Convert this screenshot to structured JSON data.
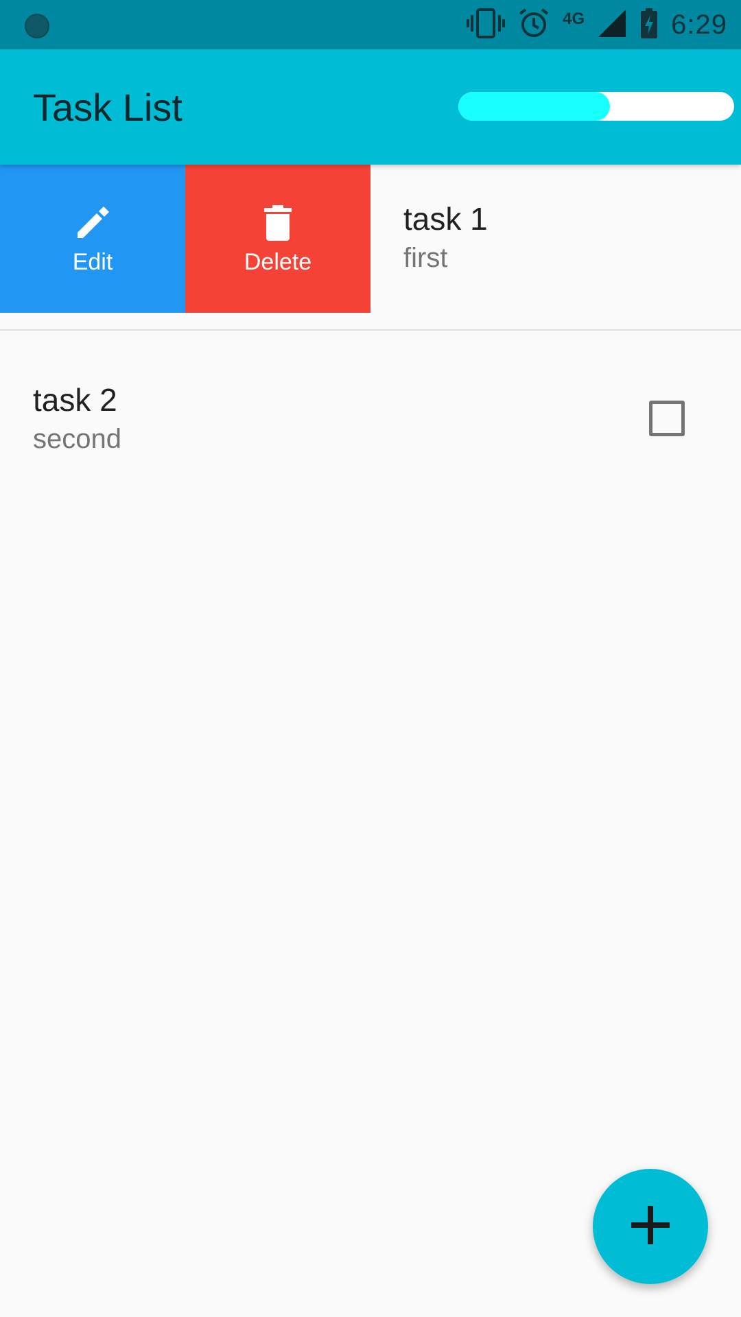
{
  "status_bar": {
    "time": "6:29",
    "network_label": "4G",
    "icons": [
      "notification-dot-icon",
      "vibrate-icon",
      "alarm-icon",
      "signal-icon",
      "battery-charging-icon"
    ]
  },
  "app_bar": {
    "title": "Task List",
    "progress_fraction": 0.55,
    "progress_color": "#18ffff",
    "background_color": "#00bcd4"
  },
  "swipe_actions": {
    "edit_label": "Edit",
    "delete_label": "Delete",
    "edit_color": "#2196f3",
    "delete_color": "#f44336"
  },
  "tasks": [
    {
      "title": "task 1",
      "subtitle": "first"
    },
    {
      "title": "task 2",
      "subtitle": "second",
      "checked": false
    }
  ],
  "fab": {
    "icon": "plus-icon"
  }
}
